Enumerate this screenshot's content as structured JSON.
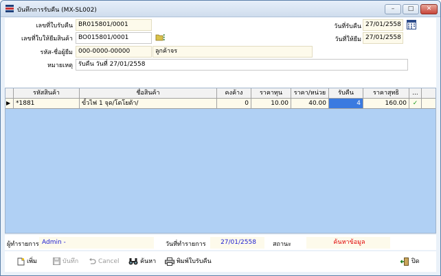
{
  "window": {
    "title": "บันทึกการรับคืน (MX-SL002)",
    "min_glyph": "–",
    "max_glyph": "□",
    "close_glyph": "✕"
  },
  "form": {
    "receipt_no_label": "เลขที่ใบรับคืน",
    "receipt_no": "BR015801/0001",
    "borrow_no_label": "เลขที่ใบให้ยืมสินค้า",
    "borrow_no": "BO015801/0001",
    "customer_label": "รหัส-ชื่อผู้ยืม",
    "customer_code": "000-0000-00000",
    "customer_name": "ลูกค้าจร",
    "note_label": "หมายเหตุ",
    "note": "รับคืน วันที่ 27/01/2558",
    "receive_date_label": "วันที่รับคืน",
    "receive_date": "27/01/2558",
    "borrow_date_label": "วันที่ให้ยืม",
    "borrow_date": "27/01/2558"
  },
  "grid": {
    "columns": [
      "รหัสสินค้า",
      "ชื่อสินค้า",
      "คงค้าง",
      "ราคาทุน",
      "ราคา/หน่วย",
      "รับคืน",
      "ราคาสุทธิ",
      "..."
    ],
    "rows": [
      {
        "marker": "▶",
        "code": "*1881",
        "name": "ขั้วไฟ 1 จุด/โตโยต้า/",
        "outstanding": "0",
        "cost": "10.00",
        "unit_price": "40.00",
        "returned": "4",
        "net_price": "160.00",
        "check": "✓"
      }
    ]
  },
  "status": {
    "operator_label": "ผู้ทำรายการ",
    "operator": "Admin -",
    "date_label": "วันที่ทำรายการ",
    "date": "27/01/2558",
    "state_label": "สถานะ",
    "state": "ค้นหาข้อมูล",
    "state_color": "#e00000",
    "value_color": "#1a1ad0"
  },
  "toolbar": {
    "add_label": "เพิ่ม",
    "save_label": "บันทึก",
    "cancel_label": "Cancel",
    "search_label": "ค้นหา",
    "print_label": "พิมพ์ใบรับคืน",
    "close_label": "ปิด"
  }
}
